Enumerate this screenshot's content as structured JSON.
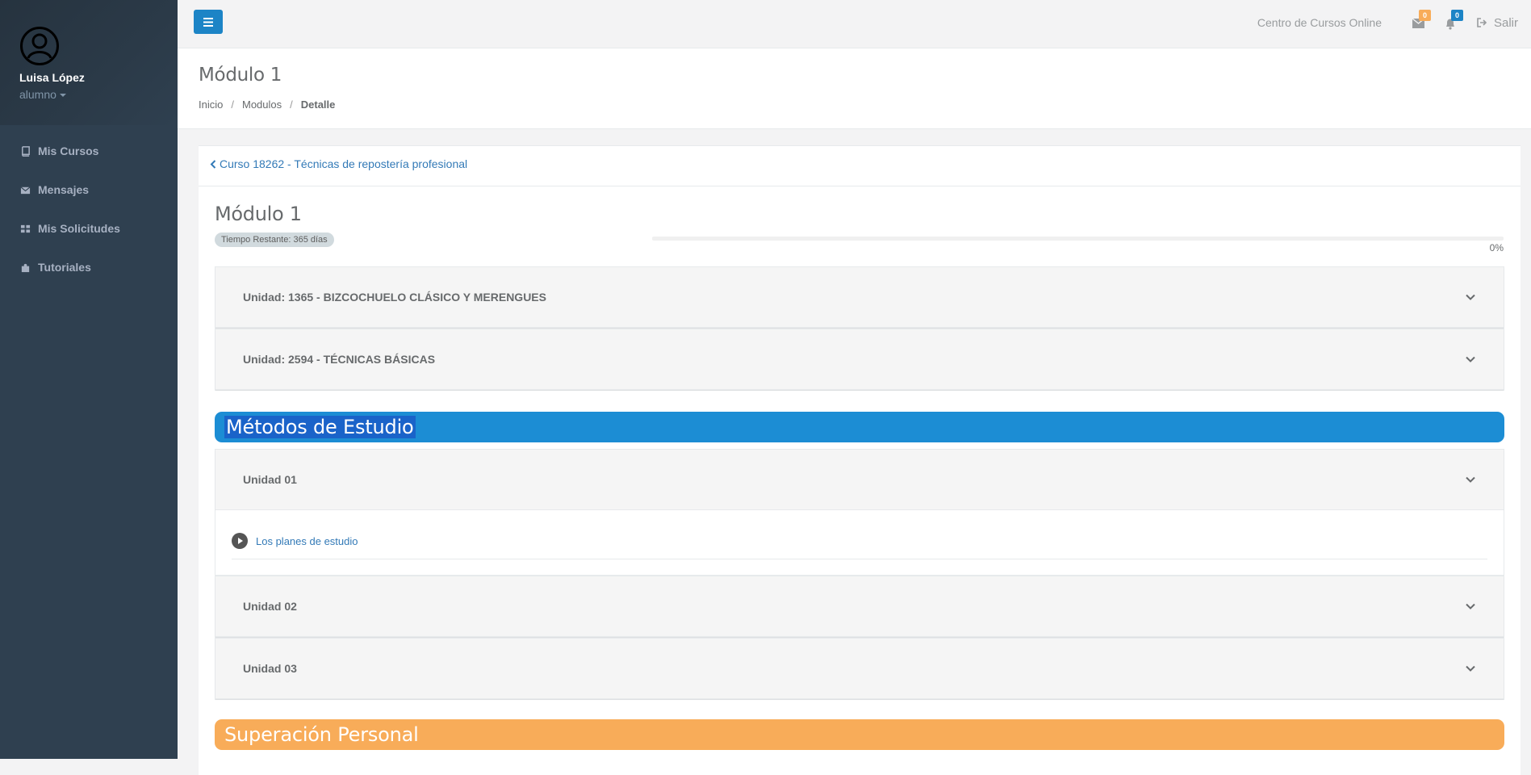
{
  "sidebar": {
    "user_name": "Luisa López",
    "user_role": "alumno",
    "items": [
      {
        "label": "Mis Cursos",
        "icon": "book-icon"
      },
      {
        "label": "Mensajes",
        "icon": "envelope-icon"
      },
      {
        "label": "Mis Solicitudes",
        "icon": "grid-icon"
      },
      {
        "label": "Tutoriales",
        "icon": "puzzle-icon"
      }
    ]
  },
  "topbar": {
    "site_link": "Centro de Cursos Online",
    "messages_count": "0",
    "notifications_count": "0",
    "logout_label": "Salir"
  },
  "heading": {
    "title": "Módulo 1",
    "breadcrumb": [
      "Inicio",
      "Modulos",
      "Detalle"
    ]
  },
  "content": {
    "back_link": "Curso 18262 - Técnicas de repostería profesional",
    "module_title": "Módulo 1",
    "time_badge": "Tiempo Restante: 365 días",
    "progress_value": 0,
    "progress_label": "0%",
    "units_top": [
      {
        "label": "Unidad: 1365 - BIZCOCHUELO CLÁSICO Y MERENGUES"
      },
      {
        "label": "Unidad: 2594 - TÉCNICAS BÁSICAS"
      }
    ],
    "section_1": {
      "title": "Métodos de Estudio",
      "color": "#1c8dd4",
      "units": [
        {
          "label": "Unidad 01",
          "expanded": true,
          "lessons": [
            "Los planes de estudio"
          ]
        },
        {
          "label": "Unidad 02",
          "expanded": false
        },
        {
          "label": "Unidad 03",
          "expanded": false
        }
      ]
    },
    "section_2": {
      "title": "Superación Personal",
      "color": "#f8ac59"
    }
  }
}
